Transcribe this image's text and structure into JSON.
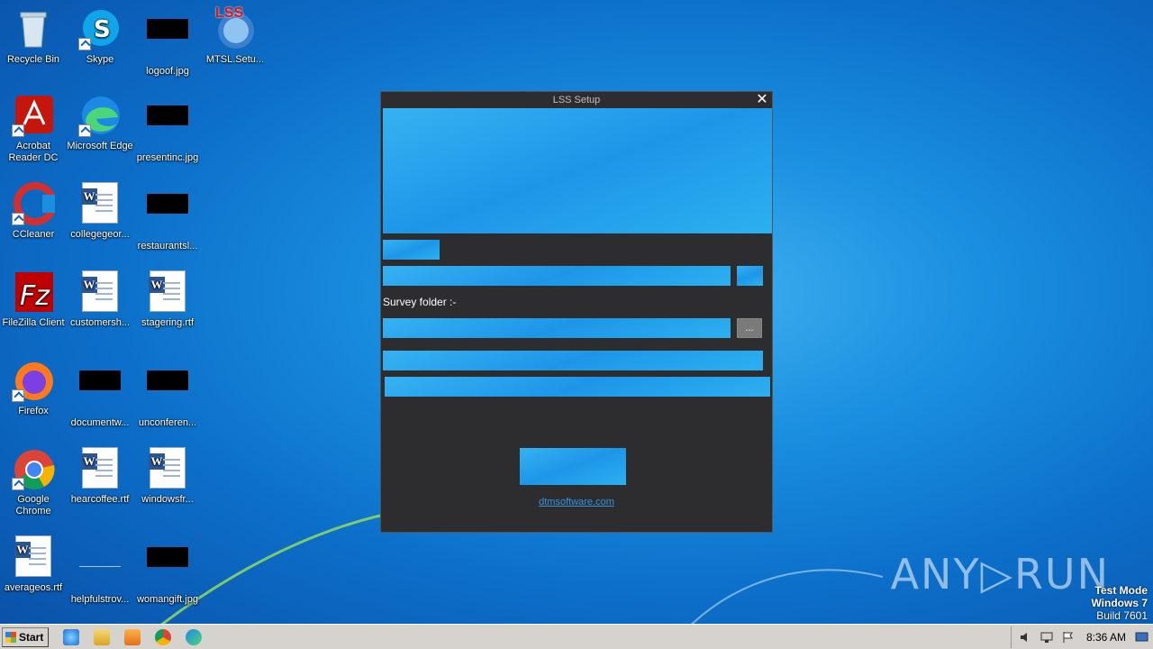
{
  "desktop": {
    "icons": [
      {
        "label": "Recycle Bin",
        "type": "recycle-bin"
      },
      {
        "label": "Skype",
        "type": "skype"
      },
      {
        "label": "logoof.jpg",
        "type": "image"
      },
      {
        "label": "MTSL.Setu...",
        "type": "setup"
      },
      {
        "label": "Acrobat Reader DC",
        "type": "acrobat"
      },
      {
        "label": "Microsoft Edge",
        "type": "edge"
      },
      {
        "label": "presentinc.jpg",
        "type": "image"
      },
      {
        "label": "CCleaner",
        "type": "ccleaner"
      },
      {
        "label": "collegegeor...",
        "type": "word"
      },
      {
        "label": "restaurantsl...",
        "type": "image"
      },
      {
        "label": "FileZilla Client",
        "type": "filezilla"
      },
      {
        "label": "customersh...",
        "type": "word"
      },
      {
        "label": "stagering.rtf",
        "type": "word"
      },
      {
        "label": "Firefox",
        "type": "firefox"
      },
      {
        "label": "documentw...",
        "type": "image"
      },
      {
        "label": "unconferen...",
        "type": "image"
      },
      {
        "label": "Google Chrome",
        "type": "chrome"
      },
      {
        "label": "hearcoffee.rtf",
        "type": "word"
      },
      {
        "label": "windowsfr...",
        "type": "word"
      },
      {
        "label": "averageos.rtf",
        "type": "word"
      },
      {
        "label": "helpfulstrov...",
        "type": "image"
      },
      {
        "label": "womangift.jpg",
        "type": "image"
      }
    ],
    "setup_icon_text": "LSS"
  },
  "dialog": {
    "title": "LSS Setup",
    "close_glyph": "✕",
    "survey_label": "Survey folder :-",
    "survey_value": "",
    "browse_label": "...",
    "link_text": "dtmsoftware.com"
  },
  "watermark": {
    "text": "ANY▷RUN",
    "test_mode": "Test Mode",
    "os": "Windows 7",
    "build": "Build 7601"
  },
  "taskbar": {
    "start_label": "Start",
    "clock": "8:36 AM",
    "pinned": [
      "internet-explorer",
      "file-explorer",
      "media-player",
      "chrome",
      "edge"
    ]
  },
  "colors": {
    "desktop_bg": "#1a8fe0",
    "dialog_bg": "#2d2d30",
    "link": "#3a8fd8",
    "taskbar_bg": "#d6d3ce"
  }
}
